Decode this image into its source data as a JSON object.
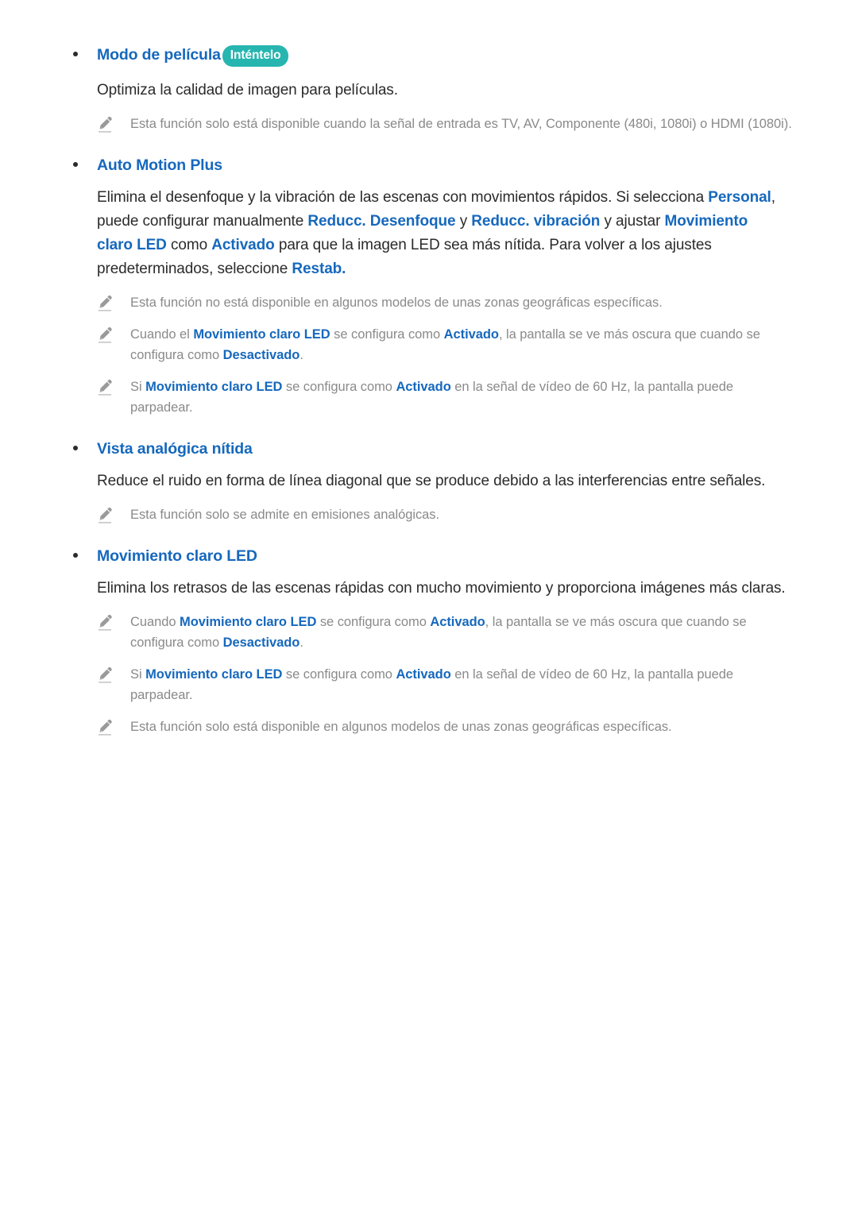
{
  "page": {
    "language": "es",
    "colors": {
      "heading_blue": "#1668bd",
      "badge_teal": "#27b5b0",
      "body_text": "#2b2b2b",
      "note_text": "#8a8a8a",
      "background": "#ffffff"
    },
    "note_icon_name": "pencil-icon"
  },
  "sections": [
    {
      "id": "modo-de-pelicula",
      "heading": "Modo de película",
      "badge": "Inténtelo",
      "body": [
        {
          "t": "Optimiza la calidad de imagen para películas.",
          "b": false
        }
      ],
      "notes": [
        [
          {
            "t": "Esta función solo está disponible cuando la señal de entrada es TV, AV, Componente (480i, 1080i) o HDMI (1080i).",
            "b": false
          }
        ]
      ]
    },
    {
      "id": "auto-motion-plus",
      "heading": "Auto Motion Plus",
      "badge": null,
      "body": [
        {
          "t": "Elimina el desenfoque y la vibración de las escenas con movimientos rápidos. Si selecciona ",
          "b": false
        },
        {
          "t": "Personal",
          "b": true
        },
        {
          "t": ", puede configurar manualmente ",
          "b": false
        },
        {
          "t": "Reducc. Desenfoque",
          "b": true
        },
        {
          "t": " y ",
          "b": false
        },
        {
          "t": "Reducc. vibración",
          "b": true
        },
        {
          "t": " y ajustar ",
          "b": false
        },
        {
          "t": "Movimiento claro LED",
          "b": true
        },
        {
          "t": " como ",
          "b": false
        },
        {
          "t": "Activado",
          "b": true
        },
        {
          "t": " para que la imagen LED sea más nítida. Para volver a los ajustes predeterminados, seleccione ",
          "b": false
        },
        {
          "t": "Restab.",
          "b": true
        }
      ],
      "notes": [
        [
          {
            "t": "Esta función no está disponible en algunos modelos de unas zonas geográficas específicas.",
            "b": false
          }
        ],
        [
          {
            "t": "Cuando el ",
            "b": false
          },
          {
            "t": "Movimiento claro LED",
            "b": true
          },
          {
            "t": " se configura como ",
            "b": false
          },
          {
            "t": "Activado",
            "b": true
          },
          {
            "t": ", la pantalla se ve más oscura que cuando se configura como ",
            "b": false
          },
          {
            "t": "Desactivado",
            "b": true
          },
          {
            "t": ".",
            "b": false
          }
        ],
        [
          {
            "t": "Si ",
            "b": false
          },
          {
            "t": "Movimiento claro LED",
            "b": true
          },
          {
            "t": " se configura como ",
            "b": false
          },
          {
            "t": "Activado",
            "b": true
          },
          {
            "t": " en la señal de vídeo de 60 Hz, la pantalla puede parpadear.",
            "b": false
          }
        ]
      ]
    },
    {
      "id": "vista-analogica-nitida",
      "heading": "Vista analógica nítida",
      "badge": null,
      "body": [
        {
          "t": "Reduce el ruido en forma de línea diagonal que se produce debido a las interferencias entre señales.",
          "b": false
        }
      ],
      "notes": [
        [
          {
            "t": "Esta función solo se admite en emisiones analógicas.",
            "b": false
          }
        ]
      ]
    },
    {
      "id": "movimiento-claro-led",
      "heading": "Movimiento claro LED",
      "badge": null,
      "body": [
        {
          "t": "Elimina los retrasos de las escenas rápidas con mucho movimiento y proporciona imágenes más claras.",
          "b": false
        }
      ],
      "notes": [
        [
          {
            "t": "Cuando ",
            "b": false
          },
          {
            "t": "Movimiento claro LED",
            "b": true
          },
          {
            "t": " se configura como ",
            "b": false
          },
          {
            "t": "Activado",
            "b": true
          },
          {
            "t": ", la pantalla se ve más oscura que cuando se configura como ",
            "b": false
          },
          {
            "t": "Desactivado",
            "b": true
          },
          {
            "t": ".",
            "b": false
          }
        ],
        [
          {
            "t": "Si ",
            "b": false
          },
          {
            "t": "Movimiento claro LED",
            "b": true
          },
          {
            "t": " se configura como ",
            "b": false
          },
          {
            "t": "Activado",
            "b": true
          },
          {
            "t": " en la señal de vídeo de 60 Hz, la pantalla puede parpadear.",
            "b": false
          }
        ],
        [
          {
            "t": "Esta función solo está disponible en algunos modelos de unas zonas geográficas específicas.",
            "b": false
          }
        ]
      ]
    }
  ]
}
